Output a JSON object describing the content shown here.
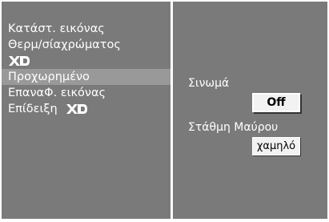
{
  "menu": {
    "items": [
      {
        "label": "Κατάστ. εικόνας"
      },
      {
        "label": "Θερμ/σίαχρώματος"
      },
      {
        "label": "",
        "logo": "XD-logo"
      },
      {
        "label": "Προχωρημένο",
        "selected": true
      },
      {
        "label": "ΕπαναΦ. εικόνας"
      },
      {
        "label": "Επίδειξη",
        "logo": "XD-logo"
      }
    ]
  },
  "settings": {
    "cinema_label": "Σινωμά",
    "cinema_value": "Off",
    "black_level_label": "Στάθμη  Μαύρου",
    "black_level_value": "χαμηλό"
  },
  "colors": {
    "background": "#7a7a7a",
    "selected": "#999999",
    "text": "#ffffff",
    "value_box": "#f2f2f2"
  }
}
